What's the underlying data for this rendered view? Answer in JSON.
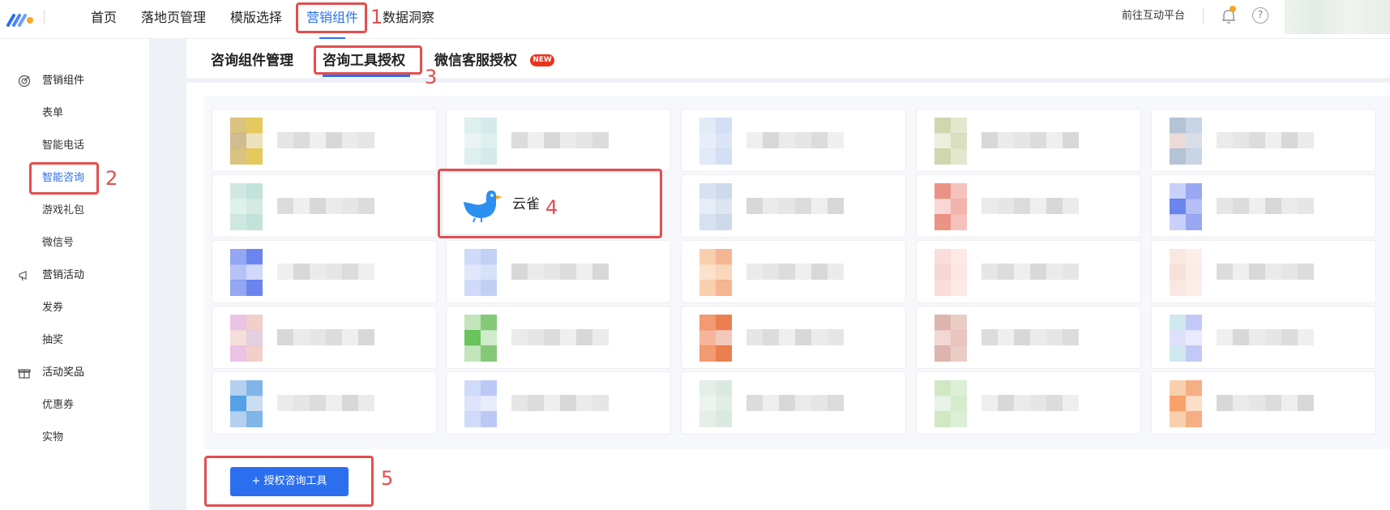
{
  "topnav": {
    "items": [
      {
        "label": "首页",
        "active": false
      },
      {
        "label": "落地页管理",
        "active": false
      },
      {
        "label": "模版选择",
        "active": false
      },
      {
        "label": "营销组件",
        "active": true
      },
      {
        "label": "数据洞察",
        "active": false
      }
    ],
    "right_link": "前往互动平台",
    "help_glyph": "?"
  },
  "sidebar": {
    "groups": [
      {
        "label": "营销组件",
        "icon": "target-icon",
        "items": [
          "表单",
          "智能电话",
          "智能咨询",
          "游戏礼包",
          "微信号"
        ]
      },
      {
        "label": "营销活动",
        "icon": "megaphone-icon",
        "items": [
          "发券",
          "抽奖"
        ]
      },
      {
        "label": "活动奖品",
        "icon": "gift-icon",
        "items": [
          "优惠券",
          "实物"
        ]
      }
    ],
    "active_item": "智能咨询"
  },
  "tabs": {
    "items": [
      "咨询组件管理",
      "咨询工具授权",
      "微信客服授权"
    ],
    "active": "咨询工具授权",
    "new_badge": "NEW"
  },
  "tools": {
    "highlighted": "云雀"
  },
  "actions": {
    "authorize_button": "+ 授权咨询工具"
  },
  "annotations": [
    "1",
    "2",
    "3",
    "4",
    "5"
  ],
  "colors": {
    "accent": "#2b6ff0",
    "annotation": "#e24e4e",
    "new_badge": "#e8341c"
  }
}
